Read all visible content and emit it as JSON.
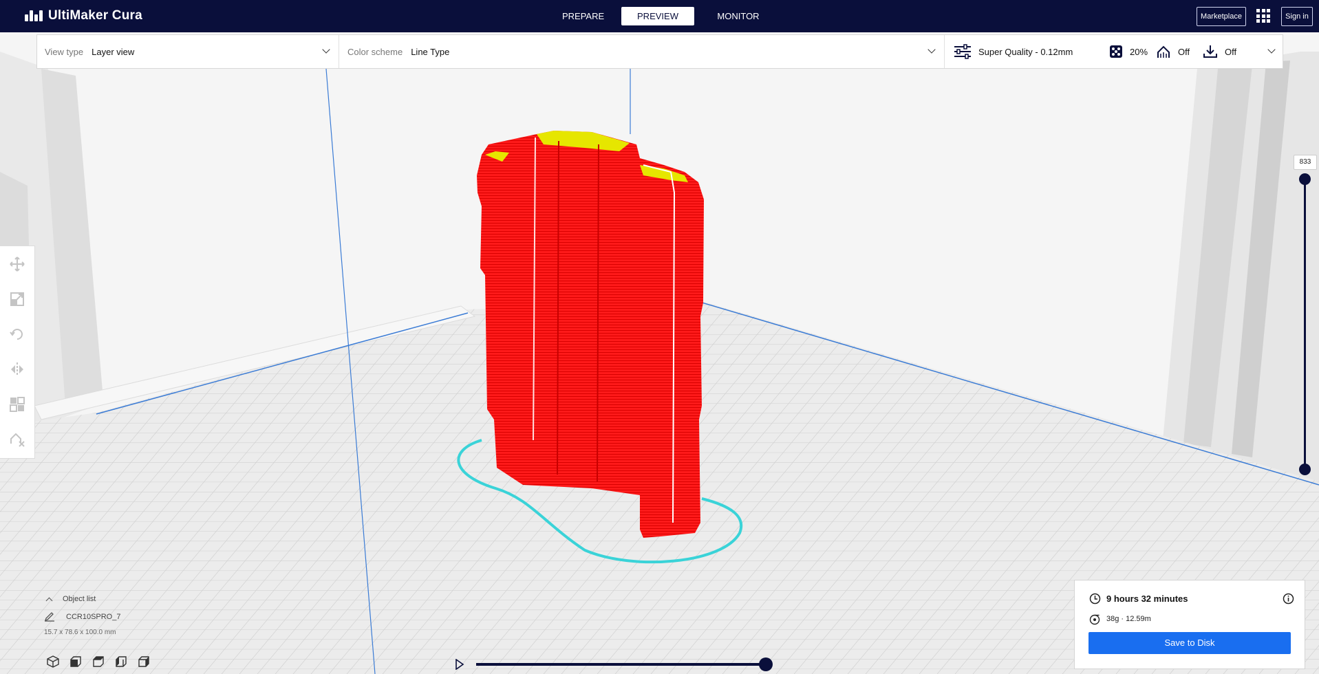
{
  "app": {
    "name": "UltiMaker Cura"
  },
  "stages": [
    {
      "label": "PREPARE",
      "active": false
    },
    {
      "label": "PREVIEW",
      "active": true
    },
    {
      "label": "MONITOR",
      "active": false
    }
  ],
  "topbar": {
    "marketplace_label": "Marketplace",
    "signin_label": "Sign in"
  },
  "view": {
    "view_type_label": "View type",
    "view_type_value": "Layer view",
    "color_scheme_label": "Color scheme",
    "color_scheme_value": "Line Type"
  },
  "print_settings": {
    "profile": "Super Quality - 0.12mm",
    "infill": "20%",
    "support": "Off",
    "adhesion": "Off"
  },
  "layer_slider": {
    "value": "833"
  },
  "object_list": {
    "header": "Object list",
    "object_name": "CCR10SPRO_7",
    "dimensions": "15.7 x 78.6 x 100.0 mm"
  },
  "print_info": {
    "time": "9 hours 32 minutes",
    "material": "38g · 12.59m",
    "save_label": "Save to Disk"
  },
  "colors": {
    "brand_dark": "#0a0f3b",
    "accent_blue": "#196ef0",
    "model_red": "#ff1a1a",
    "skin_yellow": "#e6e600",
    "skirt_cyan": "#3ad3d8"
  }
}
